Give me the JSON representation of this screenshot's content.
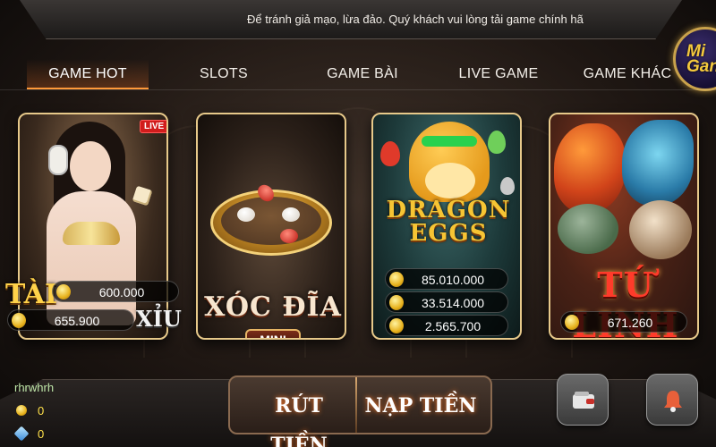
{
  "marquee": {
    "text": "Để tránh giả mạo, lừa đảo. Quý khách vui lòng tải game chính hã"
  },
  "logo": {
    "line1": "Mi",
    "line2": "Gan"
  },
  "tabs": [
    {
      "label": "GAME HOT",
      "active": true
    },
    {
      "label": "SLOTS",
      "active": false
    },
    {
      "label": "GAME BÀI",
      "active": false
    },
    {
      "label": "LIVE GAME",
      "active": false
    },
    {
      "label": "GAME KHÁC",
      "active": false
    }
  ],
  "cards": {
    "taixiu": {
      "badge": "LIVE",
      "tai_label": "TÀI",
      "xiu_label": "XỈU",
      "jackpots": [
        "600.000",
        "655.900"
      ]
    },
    "xocdia": {
      "title": "XÓC ĐĨA",
      "tag": "MINI"
    },
    "dragon": {
      "title_line1": "DRAGON",
      "title_line2": "EGGS",
      "jackpots": [
        "85.010.000",
        "33.514.000",
        "2.565.700"
      ]
    },
    "tulinh": {
      "title": "TỨ LINH",
      "jackpots": [
        "671.260"
      ]
    }
  },
  "bottom": {
    "withdraw_label": "RÚT TIỀN",
    "deposit_label": "NẠP TIỀN",
    "wallet_icon": "wallet-icon",
    "bell_icon": "bell-icon"
  },
  "user": {
    "name": "rhrwhrh",
    "gold": "0",
    "gems": "0"
  },
  "colors": {
    "accent": "#ff9a3a",
    "gold": "#f4c93c",
    "card_border": "#e7c98a",
    "tulinh_red": "#ff3b2a"
  }
}
